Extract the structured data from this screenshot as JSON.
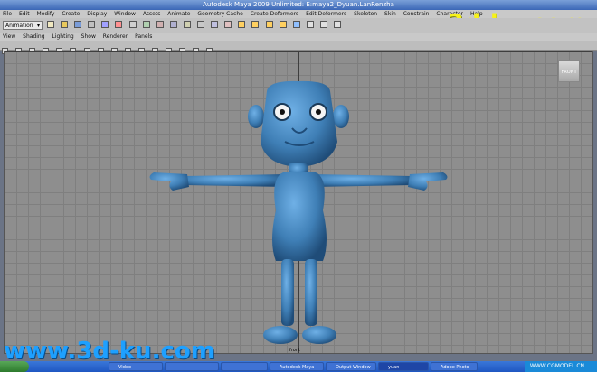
{
  "window": {
    "title": "Autodesk Maya 2009 Unlimited: E:maya2_Dyuan.LanRenzha"
  },
  "watermarks": {
    "top": "www.3d-ku.com",
    "bottom": "www.3d-ku.com",
    "corner": "WWW.CGMODEL.CN"
  },
  "menu": {
    "items": [
      "File",
      "Edit",
      "Modify",
      "Create",
      "Display",
      "Window",
      "Assets",
      "Animate",
      "Geometry Cache",
      "Create Deformers",
      "Edit Deformers",
      "Skeleton",
      "Skin",
      "Constrain",
      "Character",
      "Help"
    ]
  },
  "shelf": {
    "mode_select": "Animation"
  },
  "panel_menu": {
    "items": [
      "View",
      "Shading",
      "Lighting",
      "Show",
      "Renderer",
      "Panels"
    ]
  },
  "viewport": {
    "view_cube_label": "FRONT",
    "camera_label": "front"
  },
  "taskbar": {
    "buttons": [
      "Video",
      "",
      "",
      "",
      "Autodesk Maya",
      "Output Window",
      "yuan",
      "Adobe Photo"
    ]
  },
  "colors": {
    "character_body": "#3f7fb6",
    "viewport_bg": "#8e8e8e",
    "grid_line": "#7f7f7f"
  }
}
